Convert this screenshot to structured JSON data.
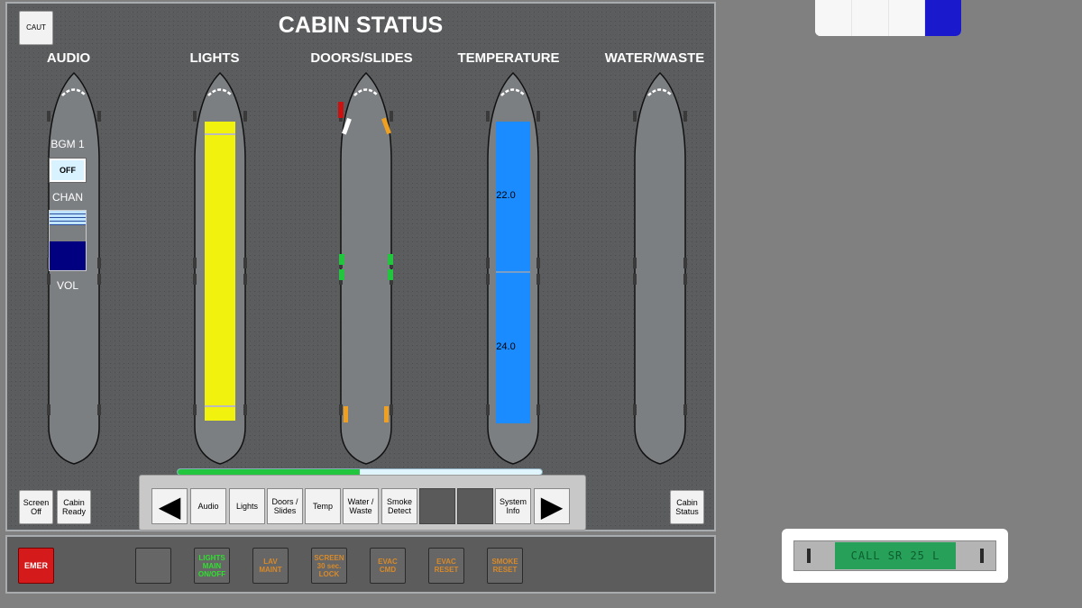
{
  "header": {
    "title": "CABIN STATUS",
    "caut_label": "CAUT"
  },
  "columns": [
    {
      "id": "audio",
      "label": "AUDIO"
    },
    {
      "id": "lights",
      "label": "LIGHTS"
    },
    {
      "id": "doors",
      "label": "DOORS/SLIDES"
    },
    {
      "id": "temperature",
      "label": "TEMPERATURE"
    },
    {
      "id": "water",
      "label": "WATER/WASTE"
    }
  ],
  "audio": {
    "bgm_label": "BGM 1",
    "bgm_state": "OFF",
    "chan_label": "CHAN",
    "vol_label": "VOL",
    "volume_level": 0.72
  },
  "temperature": {
    "fwd_zone": "22.0",
    "aft_zone": "24.0"
  },
  "left_buttons": {
    "screen_off": "Screen\nOff",
    "cabin_ready": "Cabin\nReady"
  },
  "right_button": {
    "cabin_status": "Cabin\nStatus"
  },
  "nav": {
    "progress": 0.5,
    "prev": "◀",
    "next": "▶",
    "audio": "Audio",
    "lights": "Lights",
    "doors": "Doors /\nSlides",
    "temp": "Temp",
    "water": "Water /\nWaste",
    "smoke": "Smoke\nDetect",
    "system": "System\nInfo"
  },
  "bottom": {
    "emer": "EMER",
    "lights_main": "LIGHTS\nMAIN\nON/OFF",
    "lav_maint": "LAV\nMAINT",
    "screen_lock": "SCREEN\n30 sec.\nLOCK",
    "evac_cmd": "EVAC\nCMD",
    "evac_reset": "EVAC\nRESET",
    "smoke_reset": "SMOKE\nRESET"
  },
  "call_display": {
    "text": "CALL SR 25 L"
  },
  "colors": {
    "lights_fill": "#f2f20f",
    "temp_fill": "#1a8cff",
    "door_armed": "#f0a020",
    "door_closed": "#22c53e",
    "door_alert": "#cc1111",
    "emer": "#d41a1a",
    "progress": "#22c53e"
  }
}
